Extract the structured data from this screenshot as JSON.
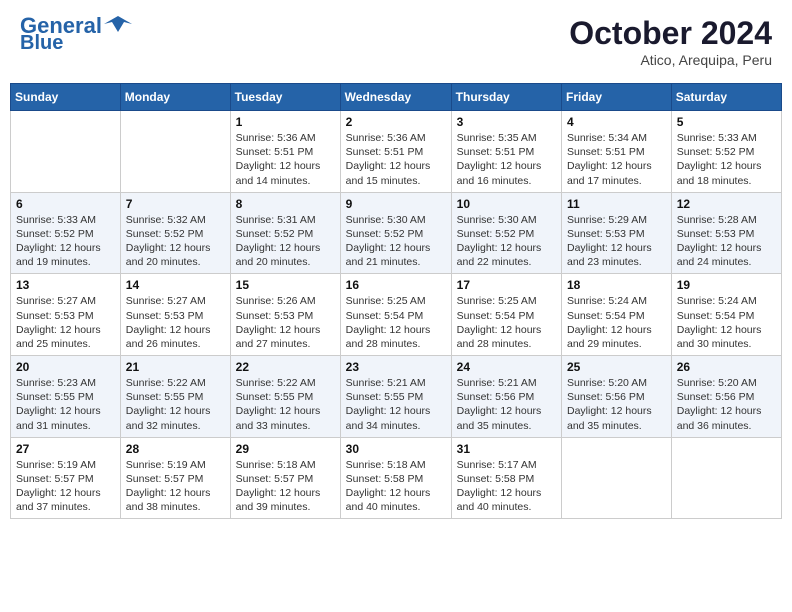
{
  "header": {
    "logo_line1": "General",
    "logo_line2": "Blue",
    "month": "October 2024",
    "location": "Atico, Arequipa, Peru"
  },
  "days_of_week": [
    "Sunday",
    "Monday",
    "Tuesday",
    "Wednesday",
    "Thursday",
    "Friday",
    "Saturday"
  ],
  "weeks": [
    [
      {
        "day": "",
        "info": ""
      },
      {
        "day": "",
        "info": ""
      },
      {
        "day": "1",
        "info": "Sunrise: 5:36 AM\nSunset: 5:51 PM\nDaylight: 12 hours and 14 minutes."
      },
      {
        "day": "2",
        "info": "Sunrise: 5:36 AM\nSunset: 5:51 PM\nDaylight: 12 hours and 15 minutes."
      },
      {
        "day": "3",
        "info": "Sunrise: 5:35 AM\nSunset: 5:51 PM\nDaylight: 12 hours and 16 minutes."
      },
      {
        "day": "4",
        "info": "Sunrise: 5:34 AM\nSunset: 5:51 PM\nDaylight: 12 hours and 17 minutes."
      },
      {
        "day": "5",
        "info": "Sunrise: 5:33 AM\nSunset: 5:52 PM\nDaylight: 12 hours and 18 minutes."
      }
    ],
    [
      {
        "day": "6",
        "info": "Sunrise: 5:33 AM\nSunset: 5:52 PM\nDaylight: 12 hours and 19 minutes."
      },
      {
        "day": "7",
        "info": "Sunrise: 5:32 AM\nSunset: 5:52 PM\nDaylight: 12 hours and 20 minutes."
      },
      {
        "day": "8",
        "info": "Sunrise: 5:31 AM\nSunset: 5:52 PM\nDaylight: 12 hours and 20 minutes."
      },
      {
        "day": "9",
        "info": "Sunrise: 5:30 AM\nSunset: 5:52 PM\nDaylight: 12 hours and 21 minutes."
      },
      {
        "day": "10",
        "info": "Sunrise: 5:30 AM\nSunset: 5:52 PM\nDaylight: 12 hours and 22 minutes."
      },
      {
        "day": "11",
        "info": "Sunrise: 5:29 AM\nSunset: 5:53 PM\nDaylight: 12 hours and 23 minutes."
      },
      {
        "day": "12",
        "info": "Sunrise: 5:28 AM\nSunset: 5:53 PM\nDaylight: 12 hours and 24 minutes."
      }
    ],
    [
      {
        "day": "13",
        "info": "Sunrise: 5:27 AM\nSunset: 5:53 PM\nDaylight: 12 hours and 25 minutes."
      },
      {
        "day": "14",
        "info": "Sunrise: 5:27 AM\nSunset: 5:53 PM\nDaylight: 12 hours and 26 minutes."
      },
      {
        "day": "15",
        "info": "Sunrise: 5:26 AM\nSunset: 5:53 PM\nDaylight: 12 hours and 27 minutes."
      },
      {
        "day": "16",
        "info": "Sunrise: 5:25 AM\nSunset: 5:54 PM\nDaylight: 12 hours and 28 minutes."
      },
      {
        "day": "17",
        "info": "Sunrise: 5:25 AM\nSunset: 5:54 PM\nDaylight: 12 hours and 28 minutes."
      },
      {
        "day": "18",
        "info": "Sunrise: 5:24 AM\nSunset: 5:54 PM\nDaylight: 12 hours and 29 minutes."
      },
      {
        "day": "19",
        "info": "Sunrise: 5:24 AM\nSunset: 5:54 PM\nDaylight: 12 hours and 30 minutes."
      }
    ],
    [
      {
        "day": "20",
        "info": "Sunrise: 5:23 AM\nSunset: 5:55 PM\nDaylight: 12 hours and 31 minutes."
      },
      {
        "day": "21",
        "info": "Sunrise: 5:22 AM\nSunset: 5:55 PM\nDaylight: 12 hours and 32 minutes."
      },
      {
        "day": "22",
        "info": "Sunrise: 5:22 AM\nSunset: 5:55 PM\nDaylight: 12 hours and 33 minutes."
      },
      {
        "day": "23",
        "info": "Sunrise: 5:21 AM\nSunset: 5:55 PM\nDaylight: 12 hours and 34 minutes."
      },
      {
        "day": "24",
        "info": "Sunrise: 5:21 AM\nSunset: 5:56 PM\nDaylight: 12 hours and 35 minutes."
      },
      {
        "day": "25",
        "info": "Sunrise: 5:20 AM\nSunset: 5:56 PM\nDaylight: 12 hours and 35 minutes."
      },
      {
        "day": "26",
        "info": "Sunrise: 5:20 AM\nSunset: 5:56 PM\nDaylight: 12 hours and 36 minutes."
      }
    ],
    [
      {
        "day": "27",
        "info": "Sunrise: 5:19 AM\nSunset: 5:57 PM\nDaylight: 12 hours and 37 minutes."
      },
      {
        "day": "28",
        "info": "Sunrise: 5:19 AM\nSunset: 5:57 PM\nDaylight: 12 hours and 38 minutes."
      },
      {
        "day": "29",
        "info": "Sunrise: 5:18 AM\nSunset: 5:57 PM\nDaylight: 12 hours and 39 minutes."
      },
      {
        "day": "30",
        "info": "Sunrise: 5:18 AM\nSunset: 5:58 PM\nDaylight: 12 hours and 40 minutes."
      },
      {
        "day": "31",
        "info": "Sunrise: 5:17 AM\nSunset: 5:58 PM\nDaylight: 12 hours and 40 minutes."
      },
      {
        "day": "",
        "info": ""
      },
      {
        "day": "",
        "info": ""
      }
    ]
  ]
}
